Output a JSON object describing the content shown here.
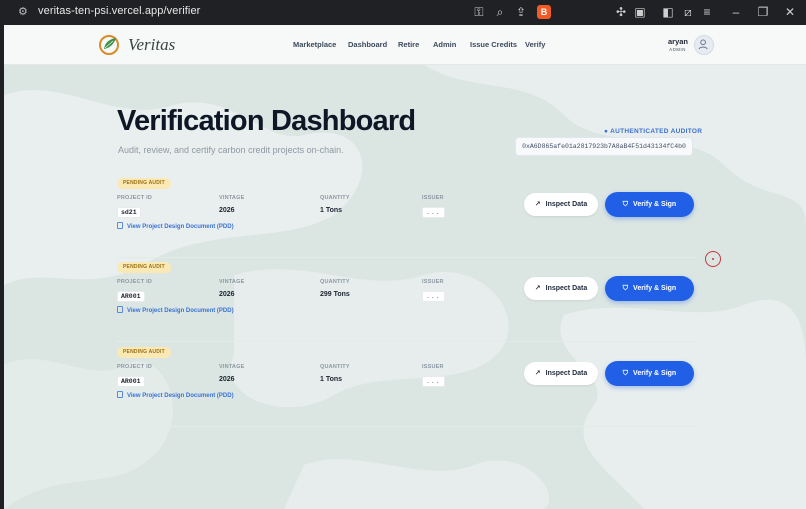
{
  "browser": {
    "url": "veritas-ten-psi.vercel.app/verifier"
  },
  "header": {
    "brand": "Veritas",
    "nav": [
      "Marketplace",
      "Dashboard",
      "Retire",
      "Admin",
      "Issue Credits",
      "Verify"
    ],
    "user": {
      "name": "aryan",
      "role": "ADMIN"
    }
  },
  "main": {
    "title": "Verification Dashboard",
    "subtitle": "Audit, review, and certify carbon credit projects on-chain.",
    "auth_label": "● AUTHENTICATED AUDITOR",
    "auditor_address": "0xA6D865afe01a2817923b7A8aB4F51d43134fC4b0",
    "field_labels": {
      "project_id": "PROJECT ID",
      "vintage": "VINTAGE",
      "quantity": "QUANTITY",
      "issuer": "ISSUER"
    },
    "pdd_link": "View Project Design Document (PDD)",
    "inspect_label": "Inspect Data",
    "verify_label": "Verify & Sign",
    "projects": [
      {
        "status": "PENDING AUDIT",
        "project_id": "sd21",
        "vintage": "2026",
        "quantity": "1 Tons",
        "issuer": "..."
      },
      {
        "status": "PENDING AUDIT",
        "project_id": "AR001",
        "vintage": "2026",
        "quantity": "299 Tons",
        "issuer": "..."
      },
      {
        "status": "PENDING AUDIT",
        "project_id": "AR001",
        "vintage": "2026",
        "quantity": "1 Tons",
        "issuer": "..."
      }
    ]
  }
}
